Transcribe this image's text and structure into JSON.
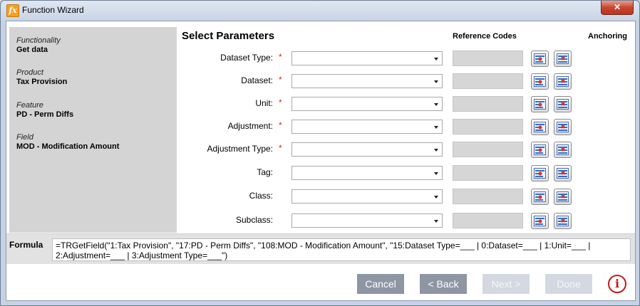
{
  "window": {
    "title": "Function Wizard",
    "app_icon_glyph": "fx",
    "close_glyph": "✕"
  },
  "info_panel": [
    {
      "label": "Functionality",
      "value": "Get data"
    },
    {
      "label": "Product",
      "value": "Tax Provision"
    },
    {
      "label": "Feature",
      "value": "PD - Perm Diffs"
    },
    {
      "label": "Field",
      "value": "MOD - Modification Amount"
    }
  ],
  "parameters": {
    "title": "Select Parameters",
    "reference_codes_header": "Reference Codes",
    "anchoring_header": "Anchoring",
    "required_mark": "*",
    "rows": [
      {
        "label": "Dataset Type:",
        "required": true,
        "value": ""
      },
      {
        "label": "Dataset:",
        "required": true,
        "value": ""
      },
      {
        "label": "Unit:",
        "required": true,
        "value": ""
      },
      {
        "label": "Adjustment:",
        "required": true,
        "value": ""
      },
      {
        "label": "Adjustment Type:",
        "required": true,
        "value": ""
      },
      {
        "label": "Tag:",
        "required": false,
        "value": ""
      },
      {
        "label": "Class:",
        "required": false,
        "value": ""
      },
      {
        "label": "Subclass:",
        "required": false,
        "value": ""
      }
    ]
  },
  "formula": {
    "label": "Formula",
    "text": "=TRGetField(\"1:Tax Provision\", \"17:PD - Perm Diffs\", \"108:MOD - Modification Amount\", \"15:Dataset Type=___ | 0:Dataset=___ | 1:Unit=___ | 2:Adjustment=___ | 3:Adjustment Type=___\")"
  },
  "buttons": {
    "cancel": "Cancel",
    "back": "< Back",
    "next": "Next >",
    "done": "Done",
    "info_glyph": "i"
  },
  "colors": {
    "required": "#dd2222",
    "info": "#c41a1a",
    "button": "#8e96a4"
  }
}
